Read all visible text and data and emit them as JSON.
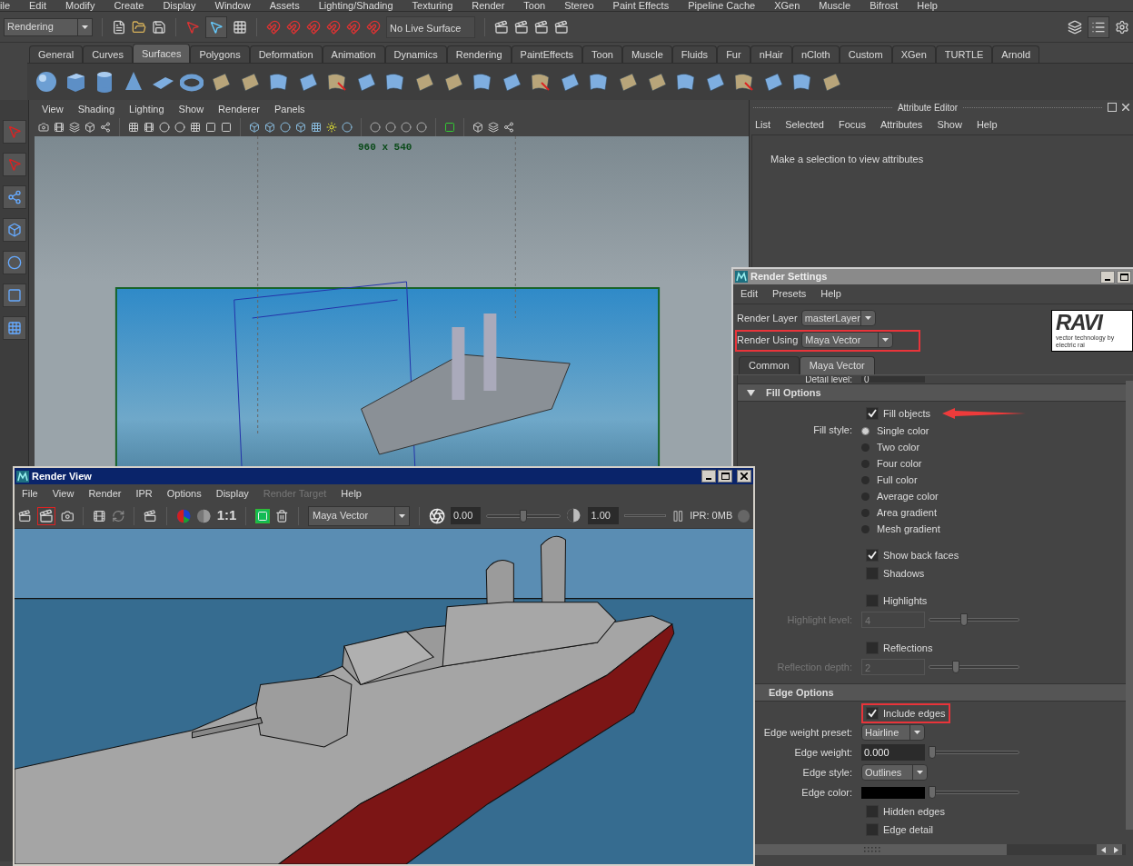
{
  "main_menu": [
    "ile",
    "Edit",
    "Modify",
    "Create",
    "Display",
    "Window",
    "Assets",
    "Lighting/Shading",
    "Texturing",
    "Render",
    "Toon",
    "Stereo",
    "Paint Effects",
    "Pipeline Cache",
    "XGen",
    "Muscle",
    "Bifrost",
    "Help"
  ],
  "status_line": {
    "menu_set": "Rendering",
    "live_surface": "No Live Surface"
  },
  "shelf_tabs": [
    {
      "label": "General",
      "selected": false
    },
    {
      "label": "Curves",
      "selected": false
    },
    {
      "label": "Surfaces",
      "selected": true
    },
    {
      "label": "Polygons",
      "selected": false
    },
    {
      "label": "Deformation",
      "selected": false
    },
    {
      "label": "Animation",
      "selected": false
    },
    {
      "label": "Dynamics",
      "selected": false
    },
    {
      "label": "Rendering",
      "selected": false
    },
    {
      "label": "PaintEffects",
      "selected": false
    },
    {
      "label": "Toon",
      "selected": false
    },
    {
      "label": "Muscle",
      "selected": false
    },
    {
      "label": "Fluids",
      "selected": false
    },
    {
      "label": "Fur",
      "selected": false
    },
    {
      "label": "nHair",
      "selected": false
    },
    {
      "label": "nCloth",
      "selected": false
    },
    {
      "label": "Custom",
      "selected": false
    },
    {
      "label": "XGen",
      "selected": false
    },
    {
      "label": "TURTLE",
      "selected": false
    },
    {
      "label": "Arnold",
      "selected": false
    }
  ],
  "viewport": {
    "menu": [
      "View",
      "Shading",
      "Lighting",
      "Show",
      "Renderer",
      "Panels"
    ],
    "resolution": "960 x 540"
  },
  "attribute_editor": {
    "title": "Attribute Editor",
    "menu": [
      "List",
      "Selected",
      "Focus",
      "Attributes",
      "Show",
      "Help"
    ],
    "message": "Make a selection to view attributes"
  },
  "render_settings": {
    "title": "Render Settings",
    "menu": [
      "Edit",
      "Presets",
      "Help"
    ],
    "render_layer": {
      "label": "Render Layer",
      "value": "masterLayer",
      "highlighted": false
    },
    "render_using": {
      "label": "Render Using",
      "value": "Maya Vector",
      "highlighted": true
    },
    "logo": {
      "wordmark": "RAVI",
      "tagline": "vector technology by electric rai"
    },
    "tabs": [
      {
        "label": "Common",
        "selected": false
      },
      {
        "label": "Maya Vector",
        "selected": true
      }
    ],
    "detail_level": {
      "label": "Detail level:",
      "value": "0"
    },
    "sections": [
      {
        "title": "Fill Options",
        "expanded": true,
        "groups": [
          [
            {
              "kind": "checkbox",
              "label": "Fill objects",
              "checked": true,
              "highlighted": false,
              "arrow": true
            },
            {
              "kind": "radio_group",
              "label": "Fill style:",
              "options": [
                {
                  "label": "Single color",
                  "selected": true
                },
                {
                  "label": "Two color",
                  "selected": false
                },
                {
                  "label": "Four color",
                  "selected": false
                },
                {
                  "label": "Full color",
                  "selected": false
                },
                {
                  "label": "Average color",
                  "selected": false
                },
                {
                  "label": "Area gradient",
                  "selected": false
                },
                {
                  "label": "Mesh gradient",
                  "selected": false
                }
              ]
            }
          ],
          [
            {
              "kind": "checkbox",
              "label": "Show back faces",
              "checked": true,
              "highlighted": false,
              "arrow": false
            },
            {
              "kind": "checkbox",
              "label": "Shadows",
              "checked": false,
              "highlighted": false,
              "arrow": false
            }
          ],
          [
            {
              "kind": "checkbox",
              "label": "Highlights",
              "checked": false,
              "highlighted": false,
              "arrow": false
            },
            {
              "kind": "slider",
              "label": "Highlight level:",
              "value": "4",
              "level": 0.43,
              "disabled": true
            }
          ],
          [
            {
              "kind": "checkbox",
              "label": "Reflections",
              "checked": false,
              "highlighted": false,
              "arrow": false
            },
            {
              "kind": "slider",
              "label": "Reflection depth:",
              "value": "2",
              "level": 0.34,
              "disabled": true
            }
          ]
        ]
      },
      {
        "title": "Edge Options",
        "groups": [
          [
            {
              "kind": "checkbox",
              "label": "Include edges",
              "checked": true,
              "highlighted": true,
              "arrow": false
            },
            {
              "kind": "dropdown",
              "label": "Edge weight preset:",
              "value": "Hairline"
            },
            {
              "kind": "slider",
              "label": "Edge weight:",
              "value": "0.000",
              "level": 0,
              "disabled": false
            },
            {
              "kind": "dropdown",
              "label": "Edge style:",
              "value": "Outlines"
            },
            {
              "kind": "color",
              "label": "Edge color:",
              "color": "#000000",
              "level": 0
            },
            {
              "kind": "checkbox",
              "label": "Hidden edges",
              "checked": false,
              "highlighted": false,
              "arrow": false
            },
            {
              "kind": "checkbox",
              "label": "Edge detail",
              "checked": false,
              "highlighted": false,
              "arrow": false
            }
          ]
        ]
      }
    ]
  },
  "render_view": {
    "title": "Render View",
    "menu": [
      {
        "label": "File",
        "disabled": false
      },
      {
        "label": "View",
        "disabled": false
      },
      {
        "label": "Render",
        "disabled": false
      },
      {
        "label": "IPR",
        "disabled": false
      },
      {
        "label": "Options",
        "disabled": false
      },
      {
        "label": "Display",
        "disabled": false
      },
      {
        "label": "Render Target",
        "disabled": true
      },
      {
        "label": "Help",
        "disabled": false
      }
    ],
    "ratio": "1:1",
    "renderer": "Maya Vector",
    "exposure": {
      "value": "0.00",
      "level": 0.5
    },
    "gamma": {
      "value": "1.00"
    },
    "ipr_memory": "IPR: 0MB"
  }
}
